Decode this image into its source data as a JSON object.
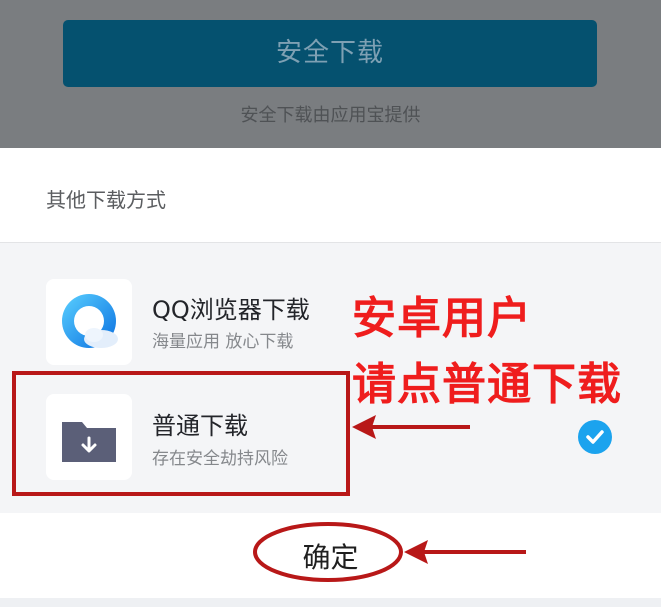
{
  "top": {
    "safe_download_label": "安全下载",
    "safe_download_note": "安全下载由应用宝提供"
  },
  "sheet": {
    "title": "其他下载方式",
    "options": [
      {
        "title": "QQ浏览器下载",
        "subtitle": "海量应用 放心下载",
        "icon": "qq-browser-icon"
      },
      {
        "title": "普通下载",
        "subtitle": "存在安全劫持风险",
        "icon": "folder-download-icon",
        "selected": true
      }
    ],
    "confirm_label": "确定"
  },
  "annotation": {
    "line1": "安卓用户",
    "line2": "请点普通下载"
  },
  "colors": {
    "annotation_red": "#ef1d1d",
    "safe_button_bg": "#05516f",
    "check_blue": "#1ba3ee",
    "overlay_gray": "#7a7d80"
  }
}
